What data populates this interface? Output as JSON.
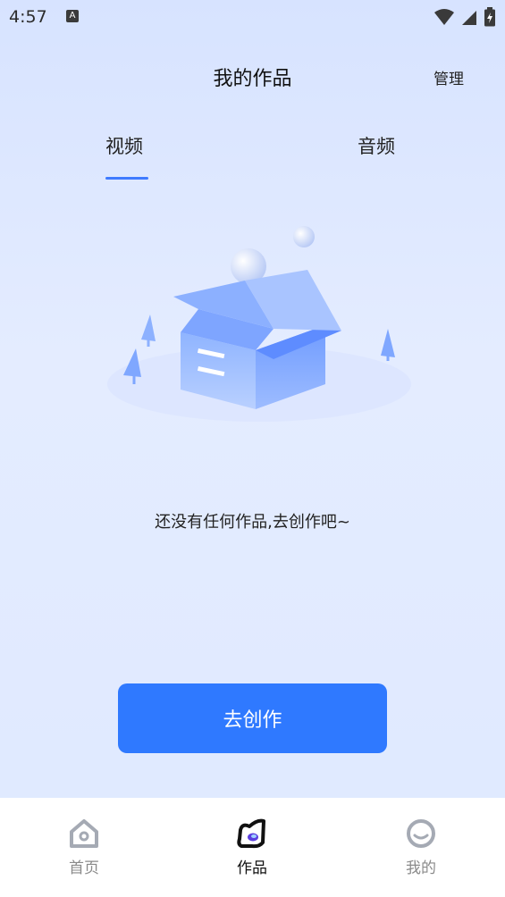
{
  "status_bar": {
    "time": "4:57",
    "app_icon": "A"
  },
  "header": {
    "title": "我的作品",
    "manage_label": "管理"
  },
  "tabs": [
    {
      "label": "视频",
      "active": true
    },
    {
      "label": "音频",
      "active": false
    }
  ],
  "empty_state": {
    "message": "还没有任何作品,去创作吧~",
    "icon": "open-box-illustration"
  },
  "create_button": {
    "label": "去创作"
  },
  "bottom_nav": [
    {
      "label": "首页",
      "icon": "home-icon",
      "active": false
    },
    {
      "label": "作品",
      "icon": "works-icon",
      "active": true
    },
    {
      "label": "我的",
      "icon": "profile-icon",
      "active": false
    }
  ],
  "colors": {
    "accent": "#2f79ff",
    "tab_indicator": "#3f7bff",
    "muted": "#8a8a8a"
  }
}
